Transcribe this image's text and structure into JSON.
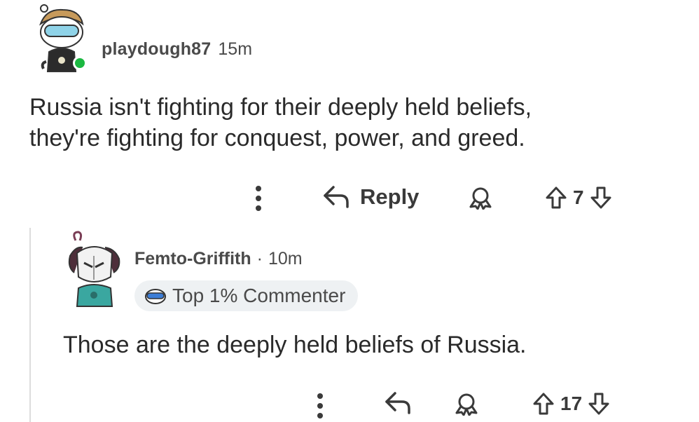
{
  "comments": [
    {
      "username": "playdough87",
      "time": "15m",
      "body_lines": [
        "Russia isn't fighting for their deeply held beliefs,",
        "they're fighting for conquest, power, and greed."
      ],
      "online": true,
      "actions": {
        "more_icon": "more-vertical-icon",
        "reply_label": "Reply",
        "reply_icon": "reply-arrow-icon",
        "award_icon": "award-icon",
        "upvote_icon": "upvote-arrow-icon",
        "downvote_icon": "downvote-arrow-icon",
        "votes": "7"
      }
    },
    {
      "username": "Femto-Griffith",
      "separator": "·",
      "time": "10m",
      "badge": {
        "icon": "commenter-badge-icon",
        "label": "Top 1% Commenter"
      },
      "body_lines": [
        "Those are the deeply held beliefs of Russia."
      ],
      "actions": {
        "more_icon": "more-vertical-icon",
        "reply_icon": "reply-arrow-icon",
        "award_icon": "award-icon",
        "upvote_icon": "upvote-arrow-icon",
        "downvote_icon": "downvote-arrow-icon",
        "votes": "17"
      }
    }
  ],
  "colors": {
    "online": "#1bb841",
    "text": "#2a2a2a",
    "meta": "#4a4a4a",
    "badge_bg": "#eef1f3",
    "thread_line": "#dcdcdc"
  }
}
